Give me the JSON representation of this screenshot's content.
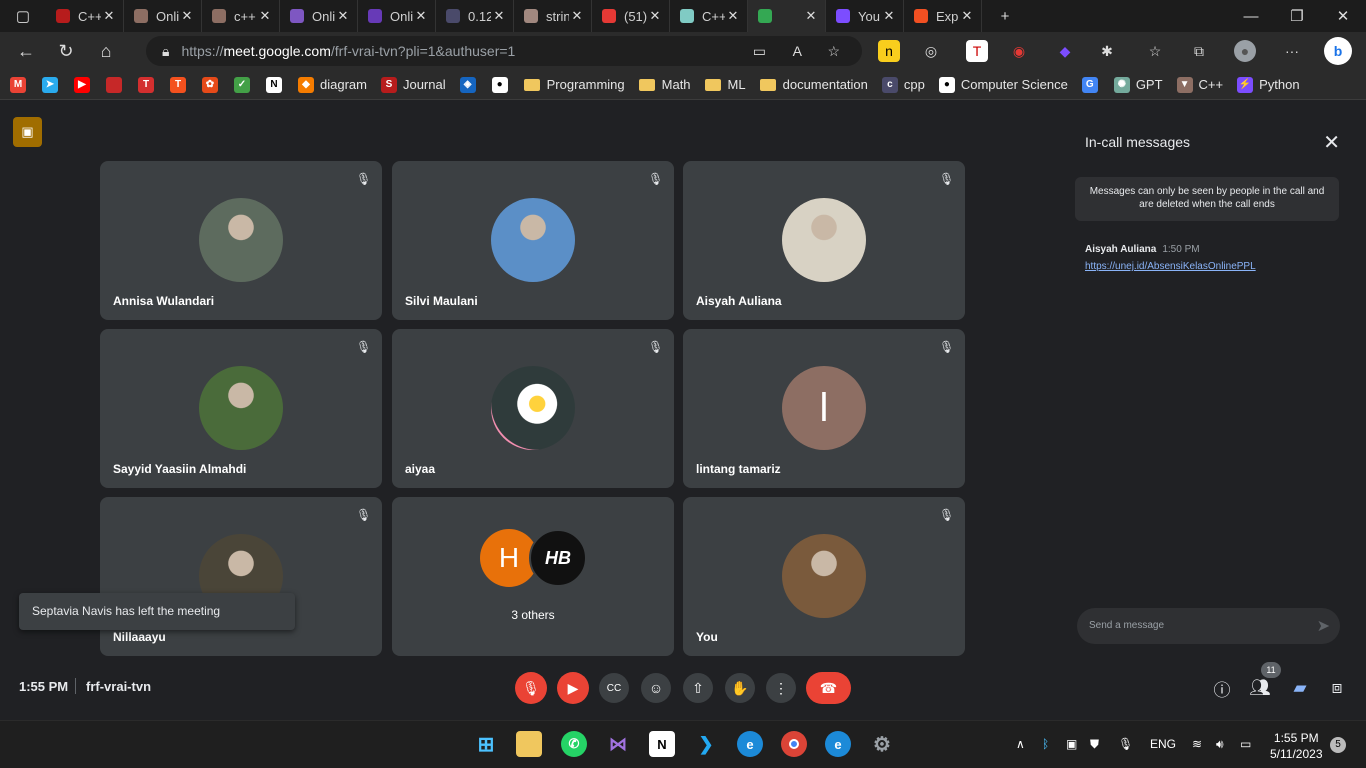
{
  "browser": {
    "tabs": [
      {
        "title": "C++",
        "favicon": "#b71c1c"
      },
      {
        "title": "Onlin",
        "favicon": "#8d6e63"
      },
      {
        "title": "c++",
        "favicon": "#8d6e63"
      },
      {
        "title": "Onlin",
        "favicon": "#7e57c2"
      },
      {
        "title": "Onlin",
        "favicon": "#673ab7"
      },
      {
        "title": "0.12",
        "favicon": "#4a4a6a"
      },
      {
        "title": "string",
        "favicon": "#a1887f"
      },
      {
        "title": "(51)",
        "favicon": "#e53935"
      },
      {
        "title": "C++",
        "favicon": "#80cbc4"
      },
      {
        "title": "",
        "favicon": "#34a853",
        "active": true
      },
      {
        "title": "You r",
        "favicon": "#7c4dff"
      },
      {
        "title": "Expo",
        "favicon": "#f25022"
      }
    ],
    "new_tab_label": "+",
    "url_prefix": "https://",
    "url_host": "meet.google.com",
    "url_path": "/frf-vrai-tvn?pli=1&authuser=1",
    "bookmarks": [
      {
        "label": "",
        "color": "#ea4335",
        "glyph": "M"
      },
      {
        "label": "",
        "color": "#2aabee",
        "glyph": "➤"
      },
      {
        "label": "",
        "color": "#ff0000",
        "glyph": "▶"
      },
      {
        "label": "",
        "color": "#c62828",
        "glyph": ""
      },
      {
        "label": "",
        "color": "#d32f2f",
        "glyph": "T"
      },
      {
        "label": "",
        "color": "#f4511e",
        "glyph": "T"
      },
      {
        "label": "",
        "color": "#e64a19",
        "glyph": "✿"
      },
      {
        "label": "",
        "color": "#43a047",
        "glyph": "✓"
      },
      {
        "label": "",
        "color": "#ffffff",
        "glyph": "N"
      },
      {
        "label": "diagram",
        "color": "#f57c00",
        "glyph": "◆"
      },
      {
        "label": "Journal",
        "color": "#b71c1c",
        "glyph": "S"
      },
      {
        "label": "",
        "color": "#1565c0",
        "glyph": "◈"
      },
      {
        "label": "",
        "color": "#ffffff",
        "glyph": "●"
      },
      {
        "label": "Programming",
        "folder": true
      },
      {
        "label": "Math",
        "folder": true
      },
      {
        "label": "ML",
        "folder": true
      },
      {
        "label": "documentation",
        "folder": true
      },
      {
        "label": "cpp",
        "color": "#4a4a6a",
        "glyph": "c"
      },
      {
        "label": "Computer Science",
        "color": "#ffffff",
        "glyph": "●"
      },
      {
        "label": "",
        "color": "#4285f4",
        "glyph": "G"
      },
      {
        "label": "GPT",
        "color": "#74aa9c",
        "glyph": "✺"
      },
      {
        "label": "C++",
        "color": "#8d6e63",
        "glyph": "▼"
      },
      {
        "label": "Python",
        "color": "#7c4dff",
        "glyph": "⚡"
      }
    ]
  },
  "meet": {
    "participants": [
      {
        "name": "Annisa Wulandari",
        "avatar_color": "#5d6b5e"
      },
      {
        "name": "Silvi Maulani",
        "avatar_color": "#5b8fc7"
      },
      {
        "name": "Aisyah Auliana",
        "avatar_color": "#d8d2c4"
      },
      {
        "name": "Sayyid Yaasiin Almahdi",
        "avatar_color": "#4a6b3a"
      },
      {
        "name": "aiyaa",
        "avatar_color": "#3a4a4a"
      },
      {
        "name": "lintang tamariz",
        "avatar_color": "#8d6e63",
        "initial": "l"
      },
      {
        "name": "Nillaaayu",
        "avatar_color": "#4a4538"
      },
      {
        "name": "3 others",
        "avatar_color": "#e8710a",
        "initial": "H"
      },
      {
        "name": "You",
        "avatar_color": "#7a5a3c"
      }
    ],
    "toast": "Septavia Navis has left the meeting",
    "time": "1:55 PM",
    "meeting_code": "frf-vrai-tvn",
    "people_count": "11",
    "panel": {
      "title": "In-call messages",
      "notice": "Messages can only be seen by people in the call and are deleted when the call ends",
      "message_author": "Aisyah Auliana",
      "message_time": "1:50 PM",
      "message_link": "https://unej.id/AbsensiKelasOnlinePPL",
      "input_placeholder": "Send a message"
    }
  },
  "taskbar": {
    "language": "ENG",
    "clock_time": "1:55 PM",
    "clock_date": "5/11/2023",
    "notification_count": "5"
  }
}
